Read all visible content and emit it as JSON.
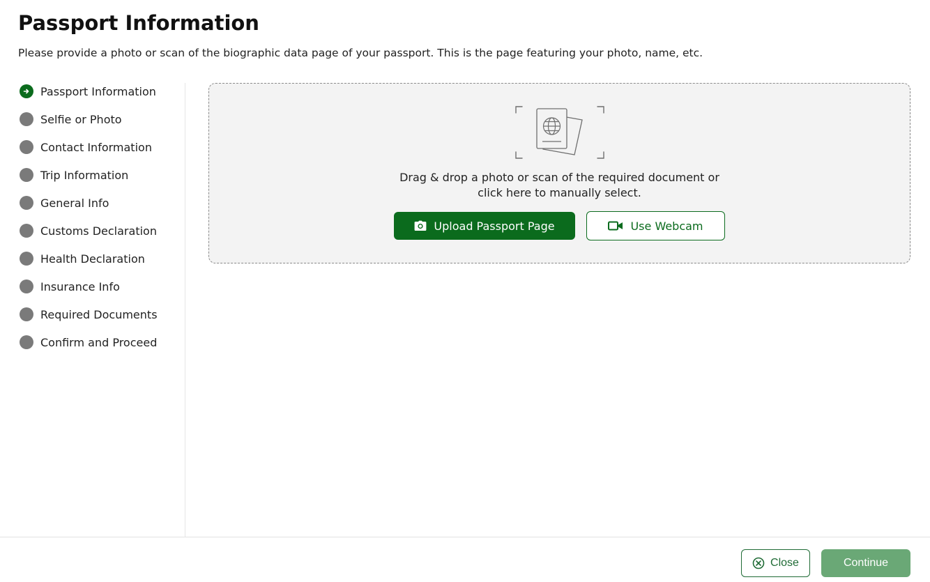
{
  "header": {
    "title": "Passport Information",
    "subtitle": "Please provide a photo or scan of the biographic data page of your passport. This is the page featuring your photo, name, etc."
  },
  "sidebar": {
    "active_index": 0,
    "steps": [
      {
        "label": "Passport Information",
        "icon": "arrow-right-circle-icon"
      },
      {
        "label": "Selfie or Photo",
        "icon": "step-dot-icon"
      },
      {
        "label": "Contact Information",
        "icon": "step-dot-icon"
      },
      {
        "label": "Trip Information",
        "icon": "step-dot-icon"
      },
      {
        "label": "General Info",
        "icon": "step-dot-icon"
      },
      {
        "label": "Customs Declaration",
        "icon": "step-dot-icon"
      },
      {
        "label": "Health Declaration",
        "icon": "step-dot-icon"
      },
      {
        "label": "Insurance Info",
        "icon": "step-dot-icon"
      },
      {
        "label": "Required Documents",
        "icon": "step-dot-icon"
      },
      {
        "label": "Confirm and Proceed",
        "icon": "step-dot-icon"
      }
    ]
  },
  "dropzone": {
    "illustration_icon": "passport-scan-icon",
    "text_line1": "Drag & drop a photo or scan of the required document or",
    "text_line2": "click here to manually select.",
    "upload_label": "Upload Passport Page",
    "upload_icon": "camera-icon",
    "webcam_label": "Use Webcam",
    "webcam_icon": "video-camera-icon"
  },
  "footer": {
    "close_label": "Close",
    "close_icon": "close-circle-icon",
    "continue_label": "Continue"
  },
  "colors": {
    "brand_green": "#0b6b1d",
    "inactive_dot": "#7a7a7a",
    "continue_disabled": "#6aa876",
    "dropzone_bg": "#f3f3f3"
  }
}
